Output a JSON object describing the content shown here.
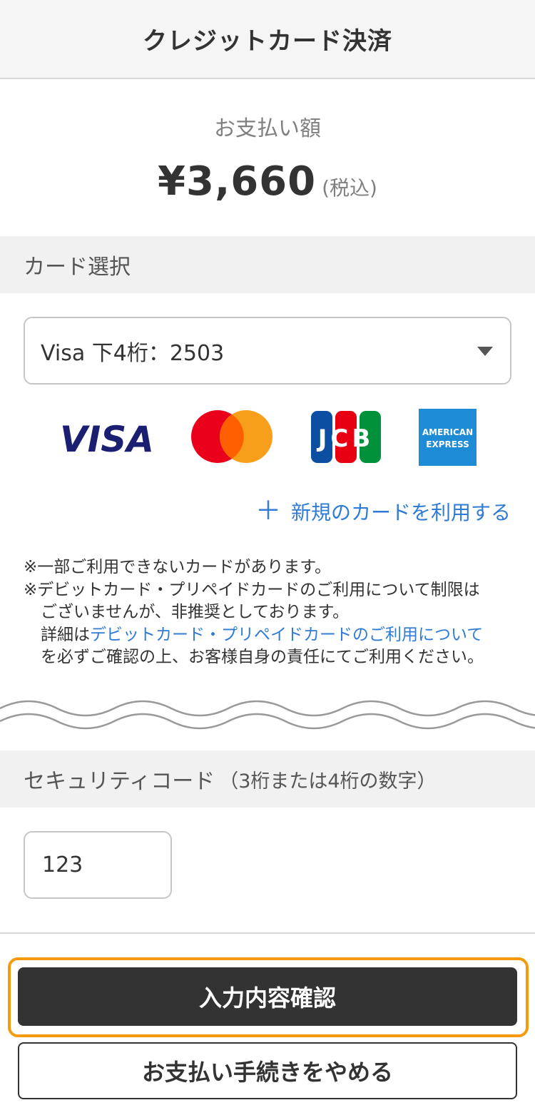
{
  "header": {
    "title": "クレジットカード決済"
  },
  "payment": {
    "label": "お支払い額",
    "amount": "¥3,660",
    "tax_note": "(税込)"
  },
  "card_section": {
    "title": "カード選択",
    "selected_card": "Visa 下4桁：2503",
    "brands": [
      {
        "name": "visa-logo",
        "text": "VISA",
        "color": "#1a1f71"
      },
      {
        "name": "mastercard-logo",
        "colors": [
          "#eb001b",
          "#f79e1b",
          "#ff5f00"
        ]
      },
      {
        "name": "jcb-logo",
        "text": "JCB",
        "colors": [
          "#0b4ea2",
          "#e60012",
          "#00913a"
        ]
      },
      {
        "name": "amex-logo",
        "text_lines": [
          "AMERICAN",
          "EXPRESS"
        ],
        "color": "#1e8bd6"
      }
    ],
    "new_card_link": "新規のカードを利用する"
  },
  "notes": {
    "line1": "※一部ご利用できないカードがあります。",
    "line2": "※デビットカード・プリペイドカードのご利用について制限は",
    "line3": "ございませんが、非推奨としております。",
    "line4_prefix": "詳細は",
    "line4_link": "デビットカード・プリペイドカードのご利用について",
    "line5": "を必ずご確認の上、お客様自身の責任にてご利用ください。"
  },
  "security": {
    "title": "セキュリティコード",
    "hint": "（3桁または4桁の数字）",
    "value": "123"
  },
  "actions": {
    "confirm_label": "入力内容確認",
    "cancel_label": "お支払い手続きをやめる"
  },
  "colors": {
    "accent_link": "#2f7bd6",
    "focus_ring": "#f59a0c",
    "primary_button": "#333333"
  }
}
